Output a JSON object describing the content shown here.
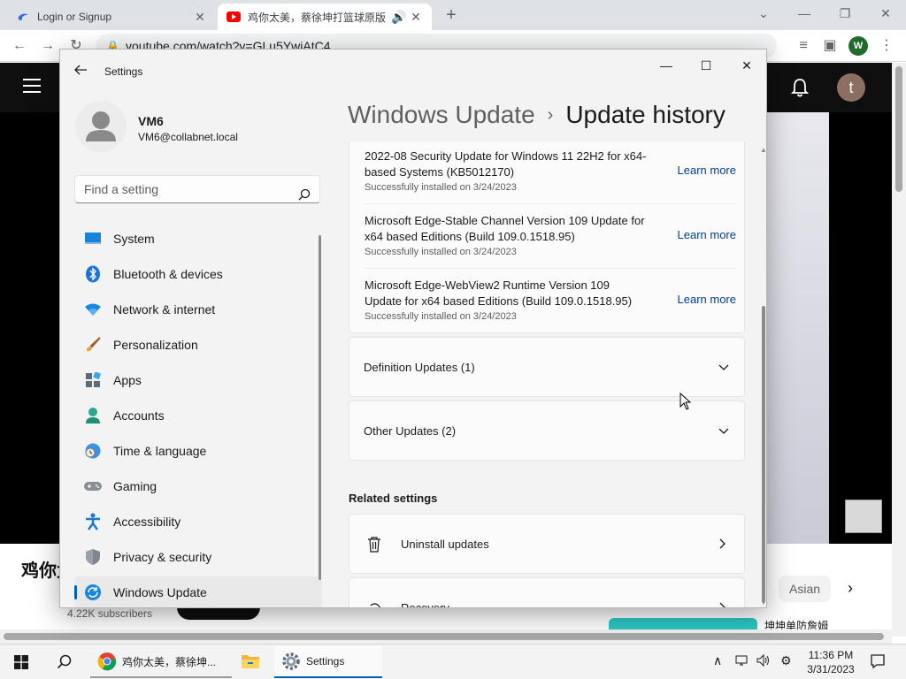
{
  "browser": {
    "tabs": [
      {
        "title": "Login or Signup",
        "active": false
      },
      {
        "title": "鸡你太美，蔡徐坤打篮球原版",
        "active": true
      }
    ],
    "address": "youtube.com/watch?v=GLu5YwiAtC4"
  },
  "youtube": {
    "avatar_letter": "t",
    "video_title": "鸡你太",
    "subscribers": "4.22K subscribers",
    "chip": "Asian",
    "related_title": "坤坤单防詹姆"
  },
  "settings": {
    "app_title": "Settings",
    "user": {
      "name": "VM6",
      "email": "VM6@collabnet.local"
    },
    "search_placeholder": "Find a setting",
    "nav": [
      {
        "label": "System",
        "icon": "system-icon"
      },
      {
        "label": "Bluetooth & devices",
        "icon": "bluetooth-icon"
      },
      {
        "label": "Network & internet",
        "icon": "wifi-icon"
      },
      {
        "label": "Personalization",
        "icon": "brush-icon"
      },
      {
        "label": "Apps",
        "icon": "apps-icon"
      },
      {
        "label": "Accounts",
        "icon": "accounts-icon"
      },
      {
        "label": "Time & language",
        "icon": "clock-globe-icon"
      },
      {
        "label": "Gaming",
        "icon": "gamepad-icon"
      },
      {
        "label": "Accessibility",
        "icon": "accessibility-icon"
      },
      {
        "label": "Privacy & security",
        "icon": "shield-icon"
      },
      {
        "label": "Windows Update",
        "icon": "update-icon",
        "selected": true
      }
    ],
    "breadcrumb": {
      "parent": "Windows Update",
      "current": "Update history"
    },
    "updates": [
      {
        "name": "2022-08 Security Update for Windows 11 22H2 for x64-based Systems (KB5012170)",
        "status": "Successfully installed on 3/24/2023",
        "link": "Learn more"
      },
      {
        "name": "Microsoft Edge-Stable Channel Version 109 Update for x64 based Editions (Build 109.0.1518.95)",
        "status": "Successfully installed on 3/24/2023",
        "link": "Learn more"
      },
      {
        "name": "Microsoft Edge-WebView2 Runtime Version 109 Update for x64 based Editions (Build 109.0.1518.95)",
        "status": "Successfully installed on 3/24/2023",
        "link": "Learn more"
      }
    ],
    "groups": [
      {
        "label": "Definition Updates (1)"
      },
      {
        "label": "Other Updates (2)"
      }
    ],
    "related_heading": "Related settings",
    "related": [
      {
        "label": "Uninstall updates",
        "icon": "trash-icon"
      },
      {
        "label": "Recovery",
        "icon": "recovery-icon"
      }
    ]
  },
  "taskbar": {
    "apps": [
      {
        "label": "鸡你太美，蔡徐坤...",
        "icon": "chrome-icon"
      },
      {
        "label": "",
        "icon": "file-explorer-icon"
      },
      {
        "label": "Settings",
        "icon": "settings-gear-icon"
      }
    ],
    "time": "11:36 PM",
    "date": "3/31/2023"
  },
  "colors": {
    "accent": "#005fb8",
    "link": "#003e92",
    "youtube_red": "#ff0000"
  }
}
